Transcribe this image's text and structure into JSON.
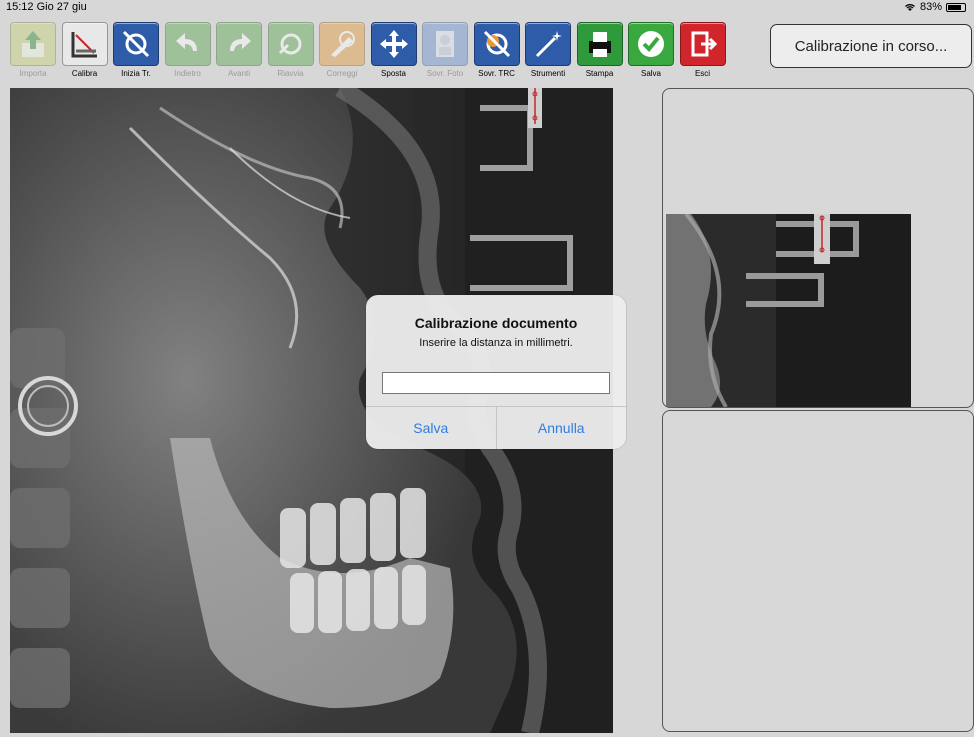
{
  "statusbar": {
    "time_date": "15:12  Gio 27 giu",
    "battery": "83%",
    "battery_level": 0.83
  },
  "toolbar": {
    "items": [
      {
        "label": "Importa",
        "icon": "import-icon",
        "color": "#c9d27a",
        "enabled": false
      },
      {
        "label": "Calibra",
        "icon": "calibrate-ruler-icon",
        "color": "#e8e8e8",
        "enabled": true
      },
      {
        "label": "Inizia Tr.",
        "icon": "start-tracing-icon",
        "color": "#2f5ca8",
        "enabled": true
      },
      {
        "label": "Indietro",
        "icon": "undo-icon",
        "color": "#5aa84f",
        "enabled": false
      },
      {
        "label": "Avanti",
        "icon": "redo-icon",
        "color": "#5aa84f",
        "enabled": false
      },
      {
        "label": "Riavvia",
        "icon": "restart-icon",
        "color": "#5aa84f",
        "enabled": false
      },
      {
        "label": "Correggi",
        "icon": "correct-icon",
        "color": "#e29a3a",
        "enabled": false
      },
      {
        "label": "Sposta",
        "icon": "move-arrows-icon",
        "color": "#2f5ca8",
        "enabled": true
      },
      {
        "label": "Sovr. Foto",
        "icon": "photo-overlay-icon",
        "color": "#6a8fd0",
        "enabled": false
      },
      {
        "label": "Sovr. TRC",
        "icon": "trc-overlay-icon",
        "color": "#2f5ca8",
        "enabled": true
      },
      {
        "label": "Strumenti",
        "icon": "tools-wand-icon",
        "color": "#2f5ca8",
        "enabled": true
      },
      {
        "label": "Stampa",
        "icon": "print-icon",
        "color": "#2e9a3c",
        "enabled": true
      },
      {
        "label": "Salva",
        "icon": "save-check-icon",
        "color": "#39a83f",
        "enabled": true
      },
      {
        "label": "Esci",
        "icon": "exit-icon",
        "color": "#d0262b",
        "enabled": true
      }
    ]
  },
  "status_button": {
    "label": "Calibrazione in corso..."
  },
  "dialog": {
    "title": "Calibrazione documento",
    "message": "Inserire la distanza in millimetri.",
    "input_value": "",
    "input_placeholder": "",
    "save_label": "Salva",
    "cancel_label": "Annulla"
  },
  "colors": {
    "accent": "#2f7de0",
    "background": "#d7d7d7"
  }
}
